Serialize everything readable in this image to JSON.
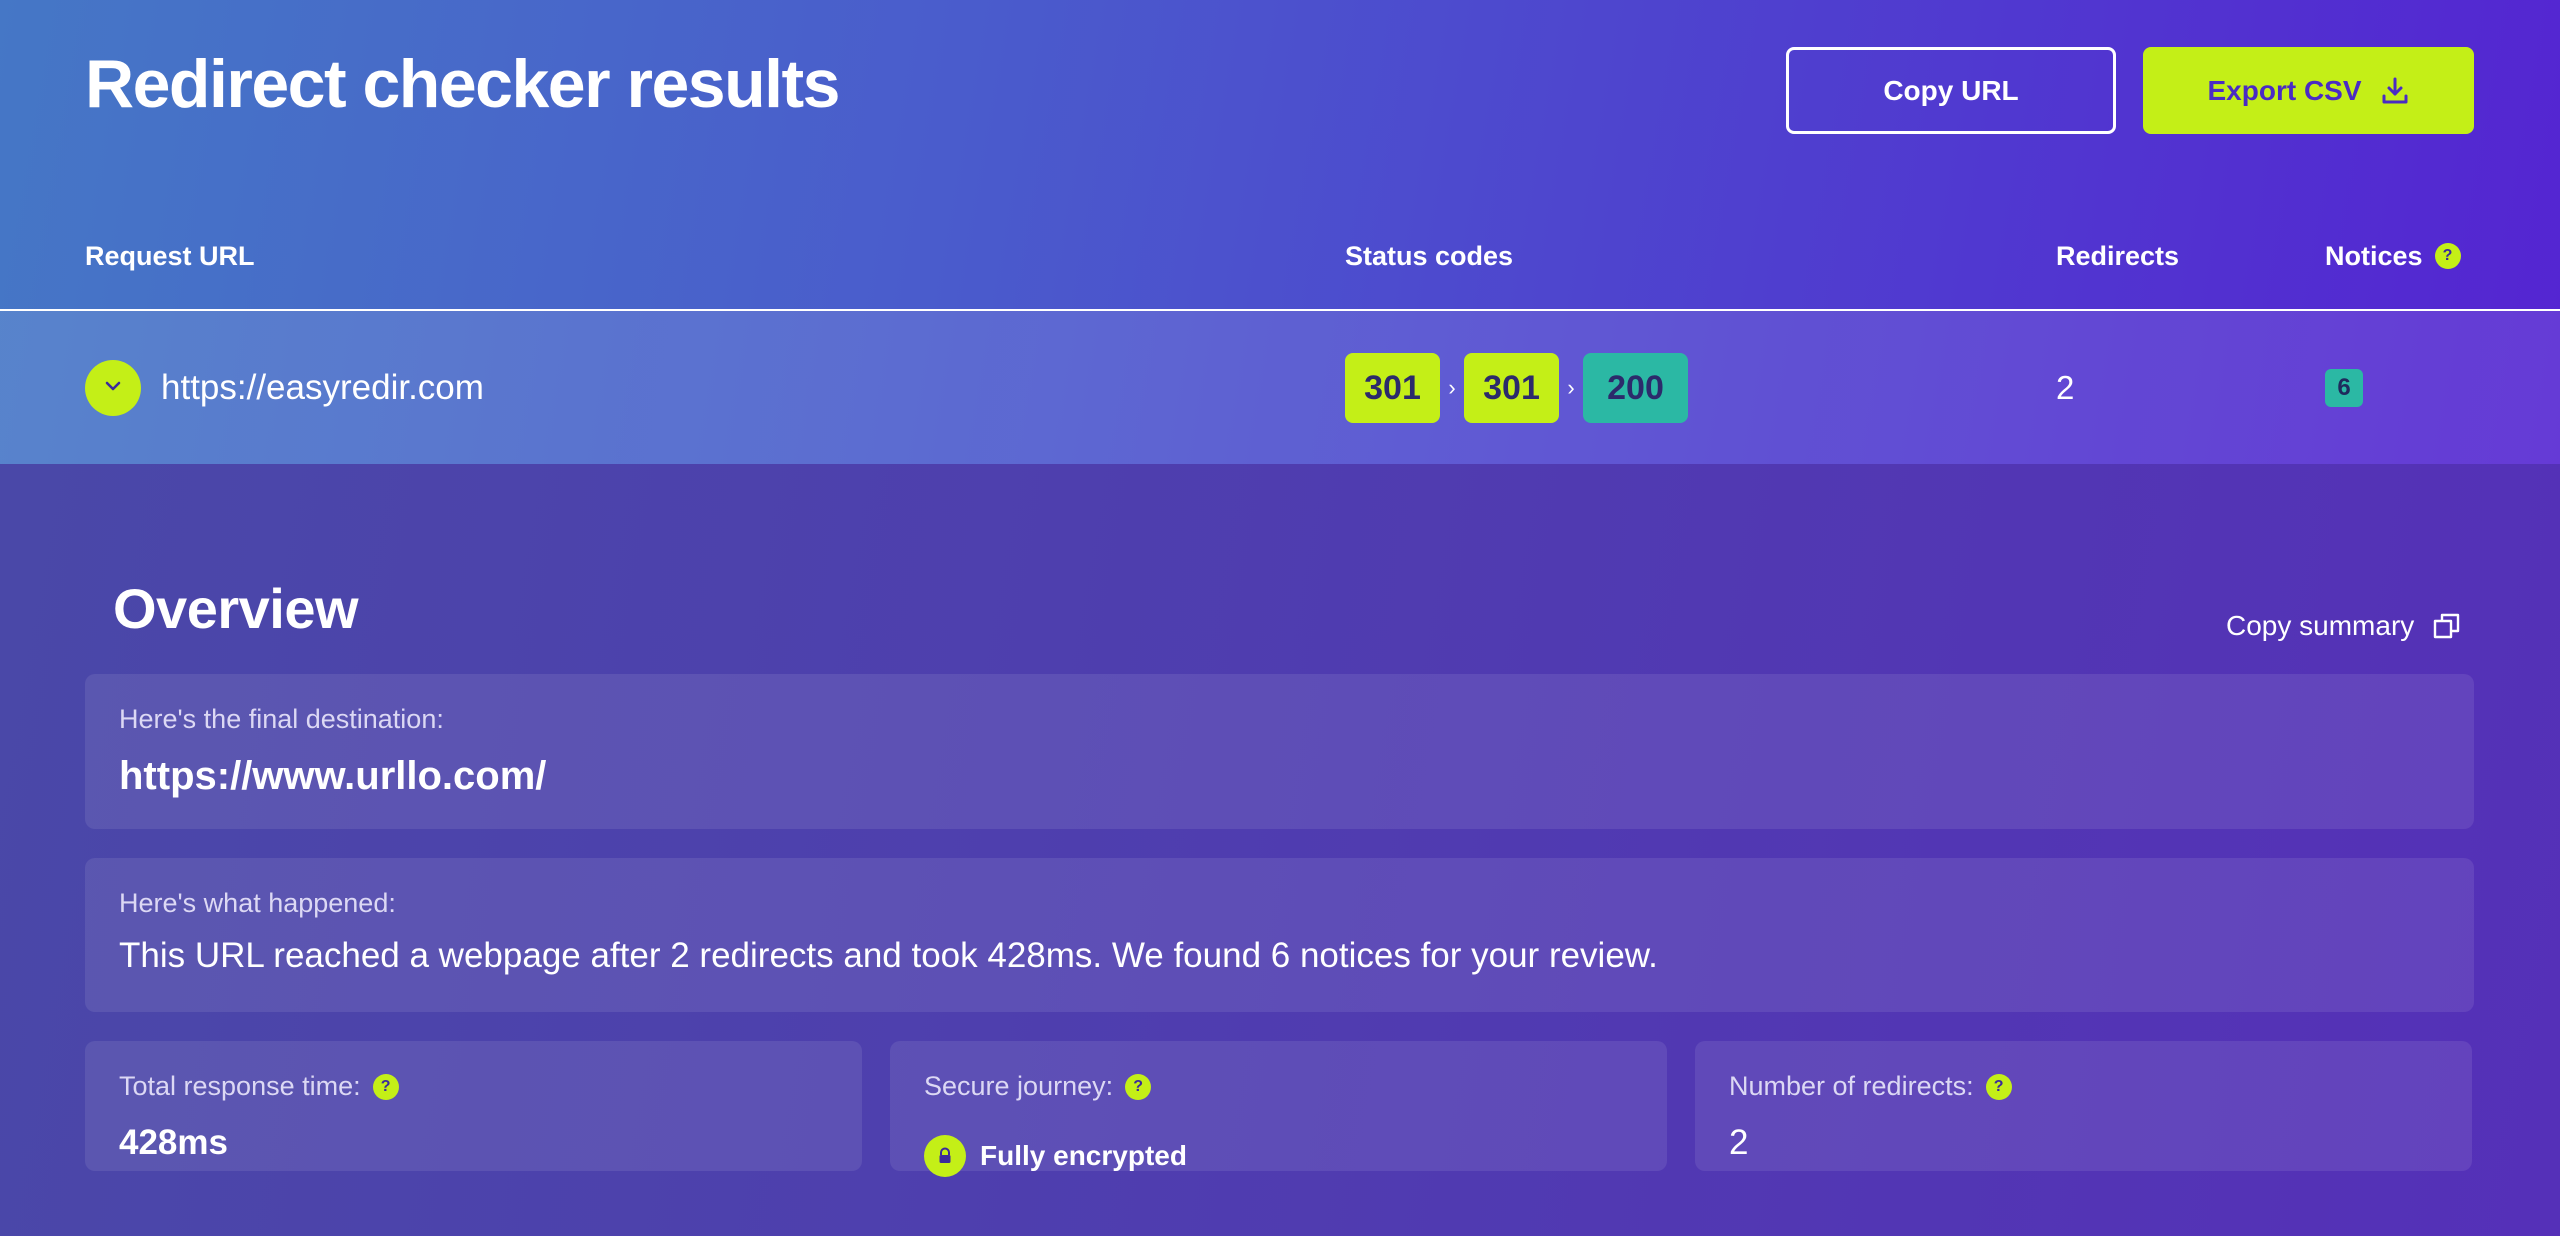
{
  "header": {
    "title": "Redirect checker results",
    "copy_url_label": "Copy URL",
    "export_csv_label": "Export CSV"
  },
  "table": {
    "columns": {
      "request_url": "Request URL",
      "status_codes": "Status codes",
      "redirects": "Redirects",
      "notices": "Notices"
    },
    "row": {
      "url": "https://easyredir.com",
      "status_codes": [
        "301",
        "301",
        "200"
      ],
      "redirects": "2",
      "notices": "6"
    }
  },
  "overview": {
    "title": "Overview",
    "copy_summary_label": "Copy summary",
    "final_destination_label": "Here's the final destination:",
    "final_destination": "https://www.urllo.com/",
    "what_happened_label": "Here's what happened:",
    "what_happened": "This URL reached a webpage after 2 redirects and took 428ms. We found 6 notices for your review.",
    "total_response_time_label": "Total response time:",
    "total_response_time": "428ms",
    "secure_journey_label": "Secure journey:",
    "secure_journey": "Fully encrypted",
    "number_of_redirects_label": "Number of redirects:",
    "number_of_redirects": "2"
  },
  "icons": {
    "help": "?",
    "expand": "chevron-down-icon",
    "download": "download-icon",
    "copy": "copy-icon",
    "lock": "lock-icon"
  },
  "colors": {
    "accent": "#c4ef17",
    "status_200": "#2bb8a4",
    "background_start": "#4577c6",
    "background_end": "#5520d2"
  }
}
